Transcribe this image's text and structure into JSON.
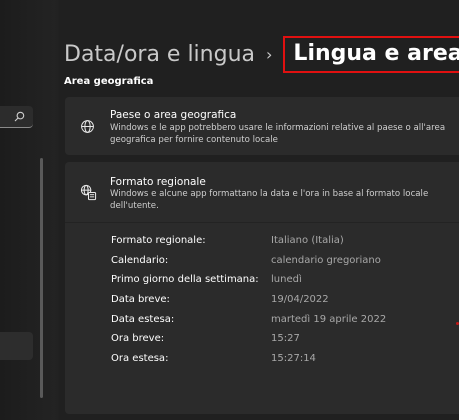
{
  "breadcrumb": {
    "parent": "Data/ora e lingua",
    "separator": "›",
    "current": "Lingua e area geografica"
  },
  "section": {
    "label": "Area geografica"
  },
  "country_card": {
    "icon": "globe-icon",
    "title": "Paese o area geografica",
    "description": "Windows e le app potrebbero usare le informazioni relative al paese o all'area geografica per fornire contenuto locale"
  },
  "format_card": {
    "icon": "regional-format-icon",
    "title": "Formato regionale",
    "description": "Windows e alcune app formattano la data e l'ora in base al formato locale dell'utente.",
    "rows": [
      {
        "label": "Formato regionale:",
        "value": "Italiano (Italia)"
      },
      {
        "label": "Calendario:",
        "value": "calendario gregoriano"
      },
      {
        "label": "Primo giorno della settimana:",
        "value": "lunedì"
      },
      {
        "label": "Data breve:",
        "value": "19/04/2022"
      },
      {
        "label": "Data estesa:",
        "value": "martedì 19 aprile 2022"
      },
      {
        "label": "Ora breve:",
        "value": "15:27"
      },
      {
        "label": "Ora estesa:",
        "value": "15:27:14"
      }
    ]
  },
  "nav": {
    "search_icon": "search-icon"
  },
  "colors": {
    "background": "#202020",
    "card": "#2b2b2b",
    "highlight_border": "#e01010",
    "secondary_text": "#a8a8a8"
  }
}
